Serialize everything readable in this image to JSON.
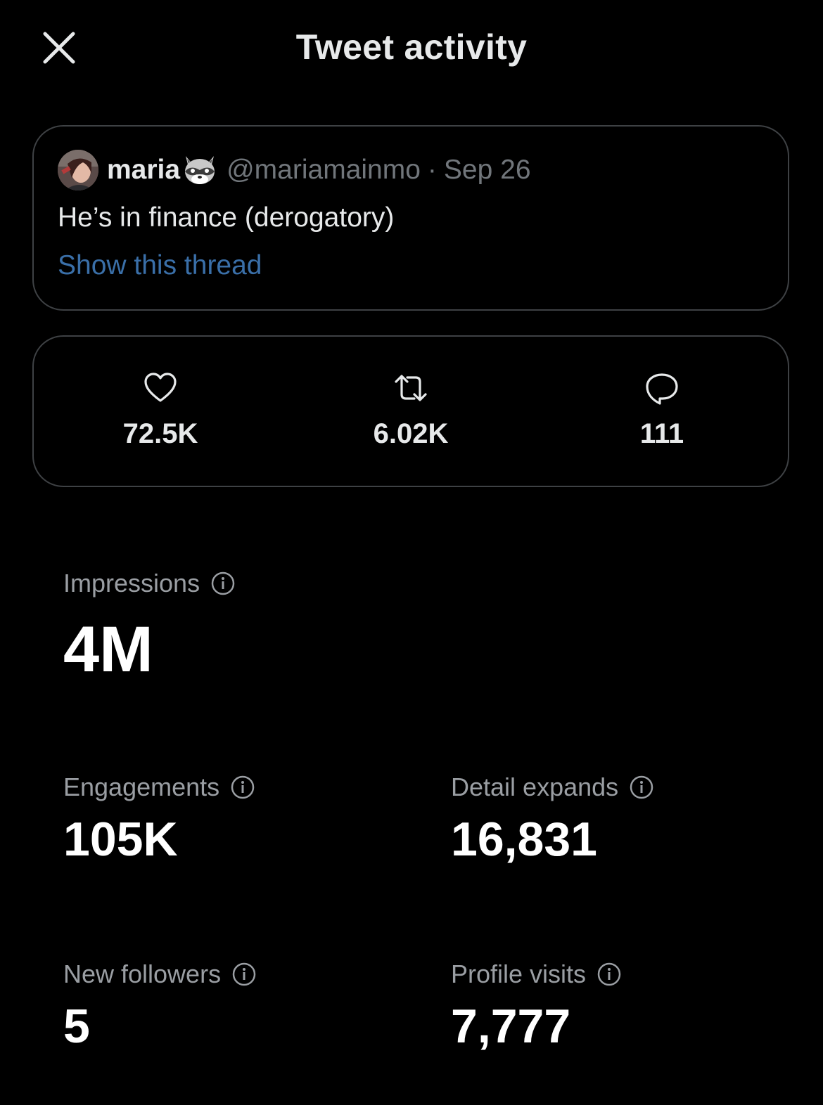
{
  "header": {
    "title": "Tweet activity",
    "close_icon": "close-icon"
  },
  "tweet": {
    "display_name": "maria",
    "name_emoji": "raccoon-icon",
    "handle": "@mariamainmo",
    "separator": "·",
    "date": "Sep 26",
    "text": "He’s in finance (derogatory)",
    "thread_link": "Show this thread",
    "link_color": "#3a6fa8"
  },
  "engagement_summary": {
    "likes": {
      "icon": "heart-icon",
      "value": "72.5K"
    },
    "retweets": {
      "icon": "retweet-icon",
      "value": "6.02K"
    },
    "replies": {
      "icon": "reply-icon",
      "value": "111"
    }
  },
  "stats": {
    "impressions": {
      "label": "Impressions",
      "value": "4M"
    },
    "engagements": {
      "label": "Engagements",
      "value": "105K"
    },
    "detail_expands": {
      "label": "Detail expands",
      "value": "16,831"
    },
    "new_followers": {
      "label": "New followers",
      "value": "5"
    },
    "profile_visits": {
      "label": "Profile visits",
      "value": "7,777"
    }
  },
  "colors": {
    "background": "#000000",
    "primary_text": "#e7e9ea",
    "secondary_text": "#71767b",
    "label_text": "#9a9ea3",
    "border": "#3e4144"
  }
}
